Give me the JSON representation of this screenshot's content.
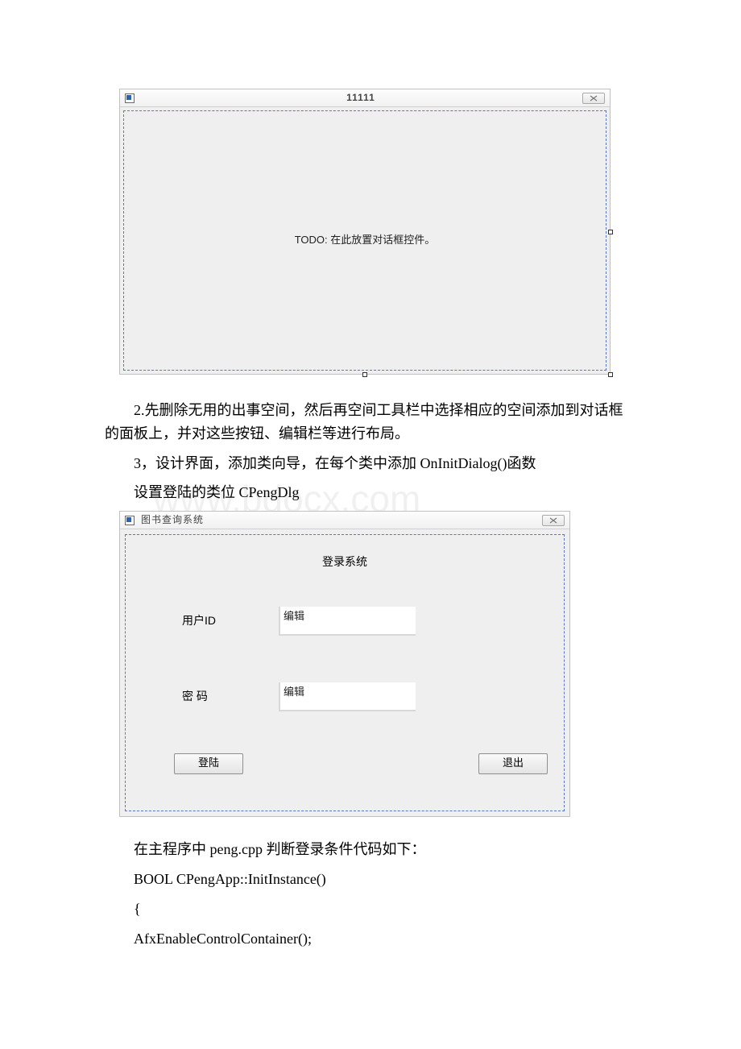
{
  "dialog1": {
    "title": "11111",
    "placeholder": "TODO: 在此放置对话框控件。"
  },
  "paragraphs": {
    "p2": "2.先删除无用的出事空间，然后再空间工具栏中选择相应的空间添加到对话框的面板上，并对这些按钮、编辑栏等进行布局。",
    "p3": "3，设计界面，添加类向导，在每个类中添加 OnInitDialog()函数",
    "p4": "设置登陆的类位 CPengDlg"
  },
  "watermark": "www.bdocx.com",
  "dialog2": {
    "title": "图书查询系统",
    "heading": "登录系统",
    "user_id_label": "用户ID",
    "password_label": "密    码",
    "input_placeholder": "编辑",
    "login_btn": "登陆",
    "exit_btn": "退出"
  },
  "code": {
    "line1": "在主程序中 peng.cpp 判断登录条件代码如下：",
    "line2": "BOOL CPengApp::InitInstance()",
    "line3": "{",
    "line4": " AfxEnableControlContainer();"
  }
}
